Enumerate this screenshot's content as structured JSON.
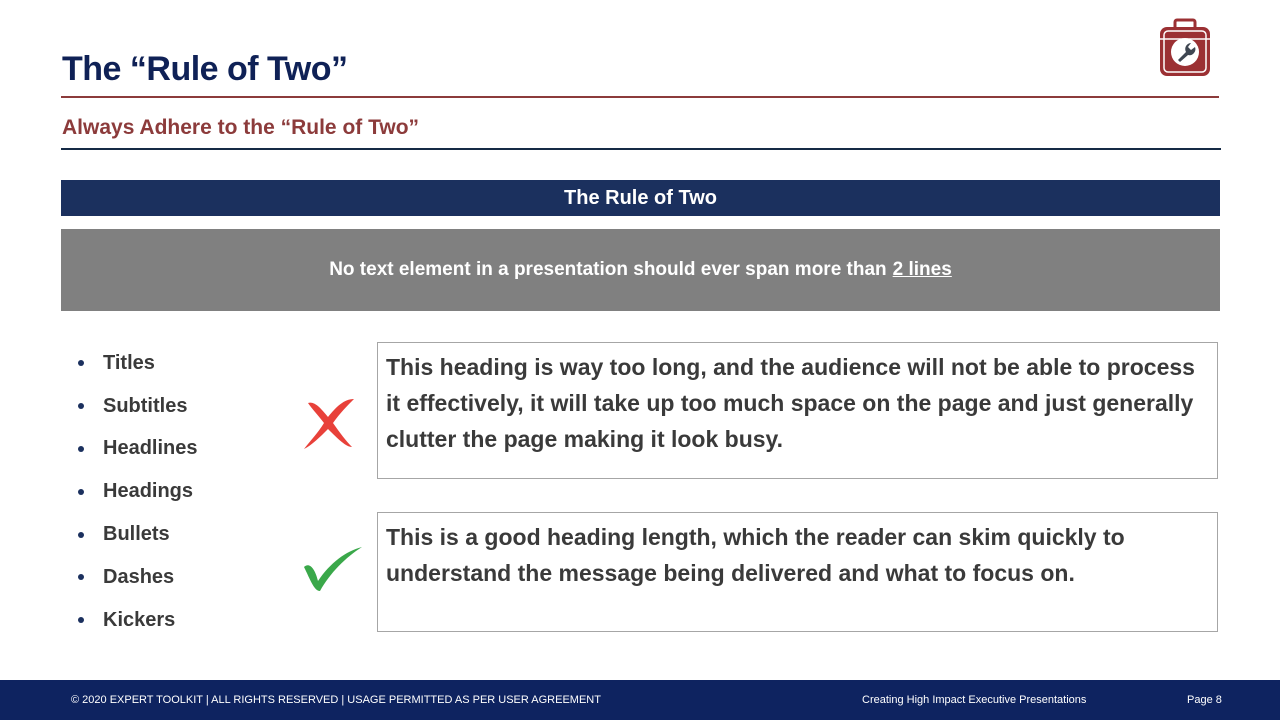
{
  "header": {
    "title": "The “Rule of Two”",
    "subtitle": "Always Adhere to the “Rule of Two”",
    "logo_icon": "toolbox-wrench-icon"
  },
  "banner": {
    "label": "The Rule of Two"
  },
  "rule": {
    "text": "No text element in a presentation should ever span more than",
    "emphasis": "2 lines"
  },
  "bullets": [
    "Titles",
    "Subtitles",
    "Headlines",
    "Headings",
    "Bullets",
    "Dashes",
    "Kickers"
  ],
  "examples": {
    "bad": {
      "icon": "red-x-icon",
      "text": "This heading is way too long, and the audience will not be able to process it effectively, it will take up too much space on the page and just generally clutter the page making it look busy."
    },
    "good": {
      "icon": "green-check-icon",
      "text": "This is a good heading length, which the reader can skim quickly to understand the message being delivered and what to focus on."
    }
  },
  "footer": {
    "copyright": "© 2020 EXPERT TOOLKIT | ALL RIGHTS RESERVED | USAGE PERMITTED AS PER USER AGREEMENT",
    "deck_title": "Creating High Impact Executive Presentations",
    "page": "Page 8"
  },
  "colors": {
    "navy": "#0f2156",
    "maroon": "#8c3b3b",
    "banner": "#1b305e",
    "grey": "#808080",
    "error_red": "#e8413a",
    "success_green": "#3aa84a"
  }
}
